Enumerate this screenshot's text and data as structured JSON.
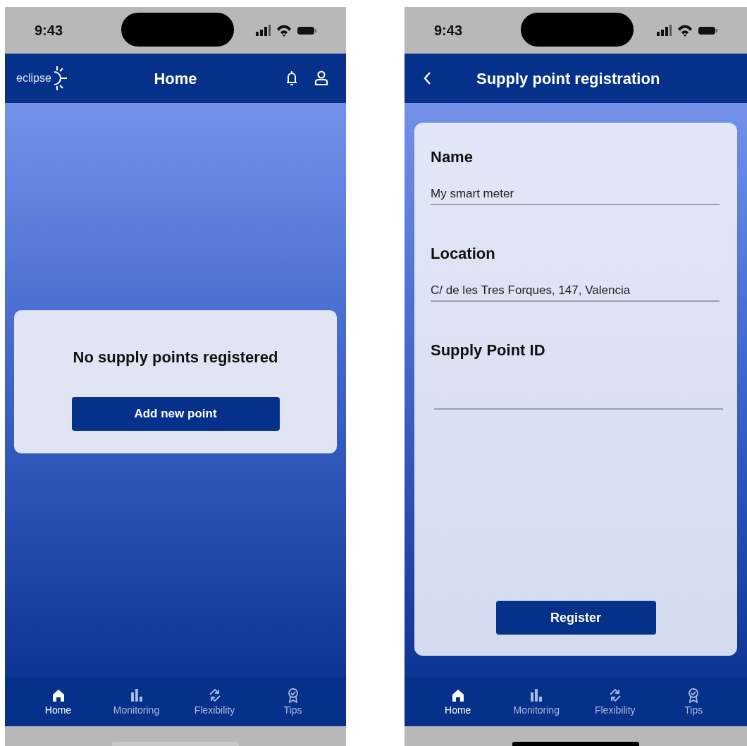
{
  "screens": [
    {
      "kind": "home",
      "status_bar": {
        "time": "9:43"
      },
      "header": {
        "logo": "eclipse",
        "title": "Home"
      },
      "card": {
        "message": "No supply points registered",
        "button": "Add new point"
      },
      "nav": [
        {
          "label": "Home",
          "selected": true
        },
        {
          "label": "Monitoring",
          "selected": false
        },
        {
          "label": "Flexibility",
          "selected": false
        },
        {
          "label": "Tips",
          "selected": false
        }
      ]
    },
    {
      "kind": "form",
      "status_bar": {
        "time": "9:43"
      },
      "header": {
        "title": "Supply point registration"
      },
      "fields": [
        {
          "label": "Name",
          "value": "My smart meter"
        },
        {
          "label": "Location",
          "value": "C/ de les Tres Forques, 147, Valencia"
        },
        {
          "label": "Supply Point ID"
        }
      ],
      "button": "Register",
      "nav": [
        {
          "label": "Home",
          "selected": true
        },
        {
          "label": "Monitoring",
          "selected": false
        },
        {
          "label": "Flexibility",
          "selected": false
        },
        {
          "label": "Tips",
          "selected": false
        }
      ]
    }
  ]
}
